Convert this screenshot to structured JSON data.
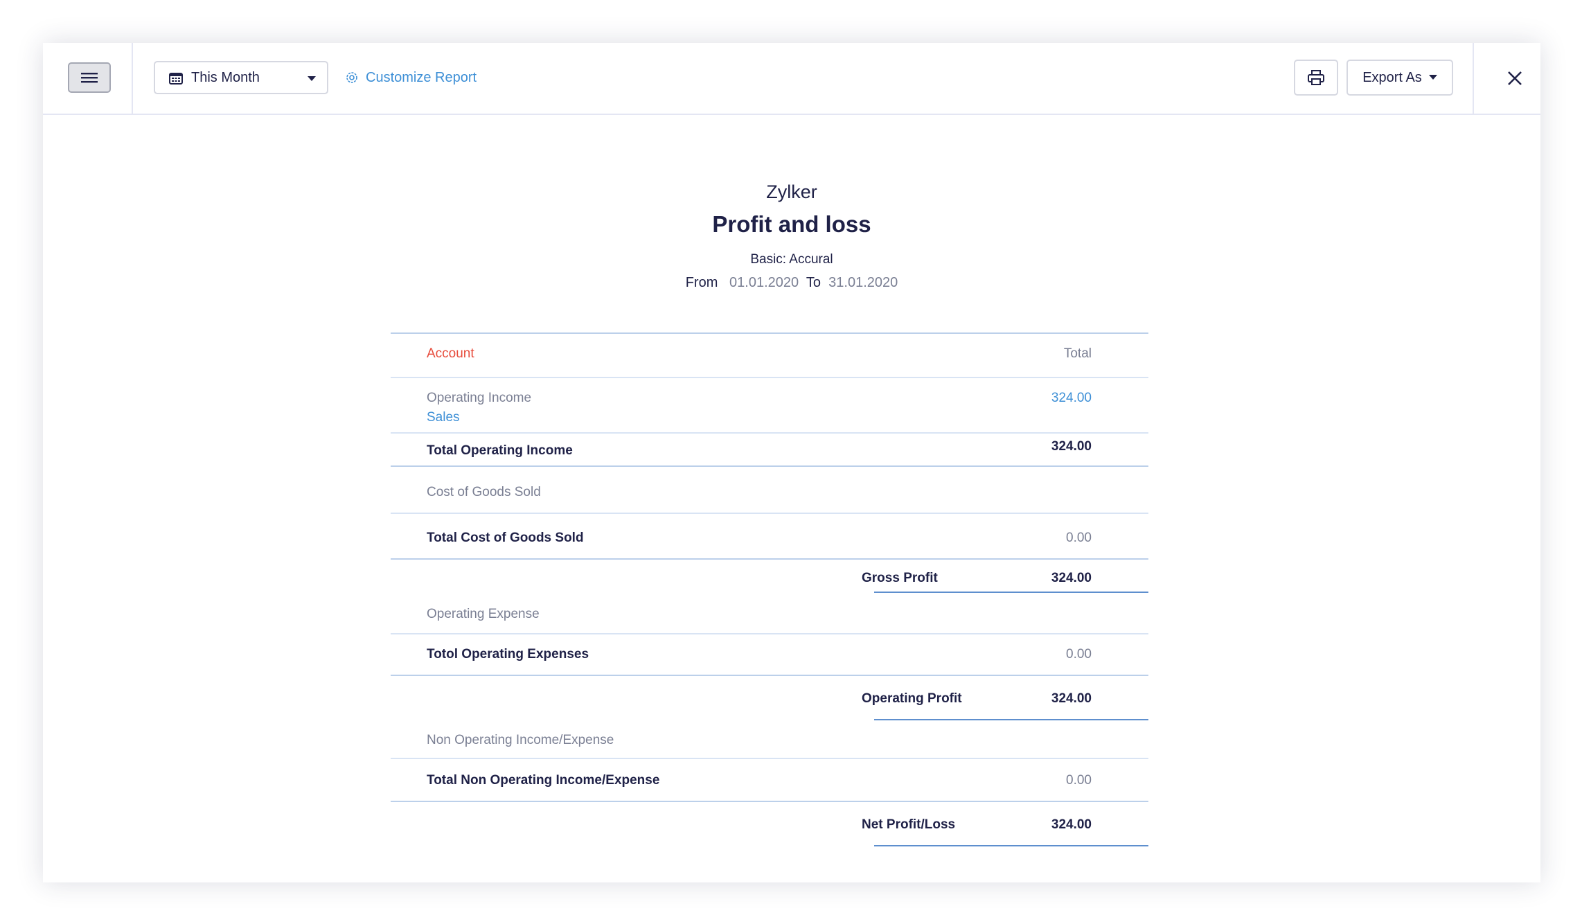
{
  "toolbar": {
    "period_label": "This Month",
    "customize_label": "Customize Report",
    "export_label": "Export As"
  },
  "report": {
    "company": "Zylker",
    "title": "Profit and loss",
    "basis": "Basic: Accural",
    "from_label": "From",
    "from_date": "01.01.2020",
    "to_label": "To",
    "to_date": "31.01.2020"
  },
  "table": {
    "header_account": "Account",
    "header_total": "Total",
    "operating_income_label": "Operating Income",
    "sales_label": "Sales",
    "sales_amount": "324.00",
    "total_operating_income_label": "Total Operating Income",
    "total_operating_income_amount": "324.00",
    "cogs_label": "Cost of Goods Sold",
    "total_cogs_label": "Total Cost of Goods Sold",
    "total_cogs_amount": "0.00",
    "gross_profit_label": "Gross Profit",
    "gross_profit_amount": "324.00",
    "operating_expense_label": "Operating Expense",
    "total_operating_expenses_label": "Totol Operating Expenses",
    "total_operating_expenses_amount": "0.00",
    "operating_profit_label": "Operating Profit",
    "operating_profit_amount": "324.00",
    "non_operating_label": "Non Operating Income/Expense",
    "total_non_operating_label": "Total Non Operating Income/Expense",
    "total_non_operating_amount": "0.00",
    "net_profit_label": "Net Profit/Loss",
    "net_profit_amount": "324.00"
  },
  "icons": {
    "menu": "hamburger-icon",
    "calendar": "calendar-icon",
    "dropdown": "caret-down-icon",
    "customize": "gear-icon",
    "print": "printer-icon",
    "close": "close-icon"
  },
  "colors": {
    "link": "#3d8fd6",
    "header_account": "#e74c3c",
    "text": "#1f2147",
    "muted": "#7a7f93",
    "total_underline": "#5e8fce"
  }
}
